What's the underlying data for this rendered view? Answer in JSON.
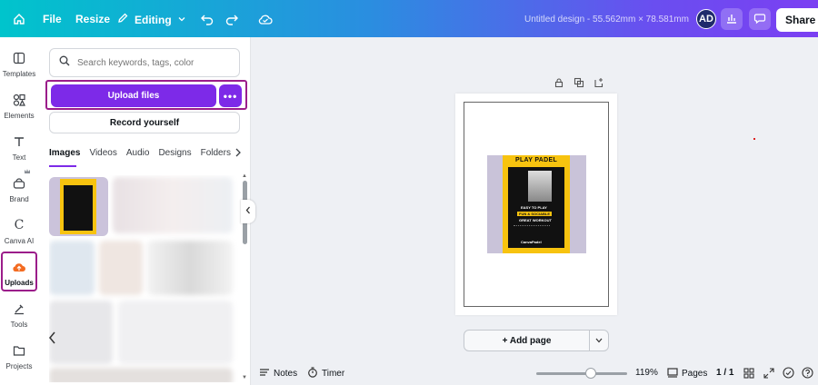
{
  "topbar": {
    "file_label": "File",
    "resize_label": "Resize",
    "mode_label": "Editing",
    "design_title": "Untitled design - 55.562mm × 78.581mm",
    "avatar_initials": "AD",
    "share_label": "Share"
  },
  "rail": {
    "items": [
      {
        "label": "Templates",
        "icon": "templates-icon"
      },
      {
        "label": "Elements",
        "icon": "elements-icon"
      },
      {
        "label": "Text",
        "icon": "text-icon"
      },
      {
        "label": "Brand",
        "icon": "brand-icon"
      },
      {
        "label": "Canva AI",
        "icon": "canva-ai-icon"
      },
      {
        "label": "Uploads",
        "icon": "uploads-icon"
      },
      {
        "label": "Tools",
        "icon": "tools-icon"
      },
      {
        "label": "Projects",
        "icon": "projects-icon"
      }
    ],
    "active": "Uploads"
  },
  "panel": {
    "search_placeholder": "Search keywords, tags, color",
    "upload_label": "Upload files",
    "more_label": "•••",
    "record_label": "Record yourself",
    "tabs": [
      "Images",
      "Videos",
      "Audio",
      "Designs",
      "Folders"
    ],
    "active_tab": "Images"
  },
  "design": {
    "poster_title": "PLAY PADEL",
    "lines": [
      "EASY TO PLAY",
      "FUN & SOCIABLE",
      "GREAT WORKOUT"
    ],
    "brand": "CanvaPadel"
  },
  "canvas": {
    "add_page_label": "+ Add page"
  },
  "bottombar": {
    "notes_label": "Notes",
    "timer_label": "Timer",
    "zoom_label": "119%",
    "zoom_fraction": 0.6,
    "pages_label": "Pages",
    "page_count": "1 / 1"
  },
  "colors": {
    "accent": "#7d2ae8",
    "highlight": "#9b1d8a",
    "poster_yellow": "#f7c30f"
  }
}
